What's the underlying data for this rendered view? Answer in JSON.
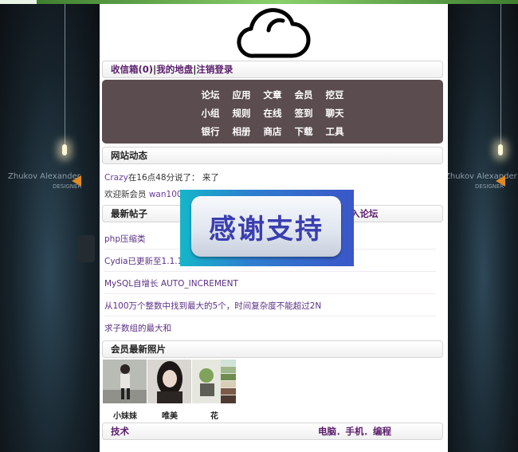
{
  "header": {
    "logo_icon": "cloud-icon",
    "user_bar": {
      "inbox": "收信箱(0)",
      "sep1": "|",
      "my_place": "我的地盘",
      "sep2": "|",
      "logout": "注销登录"
    }
  },
  "nav": {
    "rows": [
      [
        "论坛",
        "应用",
        "文章",
        "会员",
        "挖豆"
      ],
      [
        "小组",
        "规则",
        "在线",
        "签到",
        "聊天"
      ],
      [
        "银行",
        "相册",
        "商店",
        "下载",
        "工具"
      ]
    ]
  },
  "site_activity": {
    "title": "网站动态",
    "items": [
      {
        "user": "Crazy",
        "text": "在16点48分说了： 来了"
      },
      {
        "prefix": "欢迎新会员 ",
        "user": "wan100"
      }
    ]
  },
  "latest_posts": {
    "title": "最新帖子",
    "title_right": "入论坛",
    "items": [
      "php压缩类",
      "Cydia已更新至1.1.1",
      "MySQL自增长 AUTO_INCREMENT",
      "从100万个整数中找到最大的5个，时间复杂度不能超过2N",
      "求子数组的最大和"
    ]
  },
  "member_photos": {
    "title": "会员最新照片",
    "items": [
      {
        "caption": "小妹妹"
      },
      {
        "caption": "唯美"
      },
      {
        "caption": "花"
      }
    ]
  },
  "footer_bar": {
    "left": "技术",
    "right": "电脑．手机．编程"
  },
  "popup": {
    "text": "感谢支持"
  },
  "side_decor": {
    "left_text": "Zhukov  Alexander",
    "left_sub": "DESIGNER",
    "right_text": "Zhukov  Alexander",
    "right_sub": "DESIGNER"
  },
  "colors": {
    "nav_bg": "#5b4c4f",
    "link": "#5a1d6b",
    "popup_text": "#3b3eb0"
  }
}
